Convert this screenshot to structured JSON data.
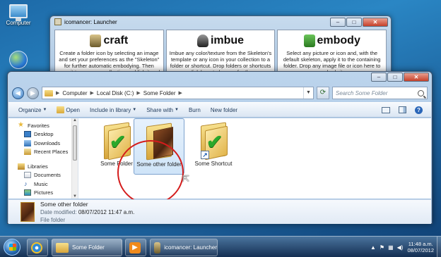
{
  "desktop": {
    "computer_label": "Computer"
  },
  "launcher": {
    "title": "icomancer: Launcher",
    "panels": [
      {
        "heading": "craft",
        "description": "Create a folder icon by selecting an image and set your preferences as the \"Skeleton\" for further automatic embodying. Then save it to your new collection, publish it and share it with your friends!"
      },
      {
        "heading": "imbue",
        "description": "Imbue any color/texture from the Skeleton's template or any icon in your collection to a folder or shortcut. Drop folders or shortcuts or click here to browse for them."
      },
      {
        "heading": "embody",
        "description": "Select any picture or icon and, with the default skeleton, apply it to the containing folder. Drop any image file or icon here to embody it."
      }
    ]
  },
  "explorer": {
    "breadcrumb": [
      "Computer",
      "Local Disk (C:)",
      "Some Folder"
    ],
    "search_placeholder": "Search Some Folder",
    "commands": {
      "organize": "Organize",
      "open": "Open",
      "include": "Include in library",
      "share": "Share with",
      "burn": "Burn",
      "new_folder": "New folder"
    },
    "nav": {
      "favorites": "Favorites",
      "desktop": "Desktop",
      "downloads": "Downloads",
      "recent": "Recent Places",
      "libraries": "Libraries",
      "documents": "Documents",
      "music": "Music",
      "pictures": "Pictures"
    },
    "files": [
      {
        "name": "Some Folder"
      },
      {
        "name": "Some other folder"
      },
      {
        "name": "Some Shortcut"
      }
    ],
    "details": {
      "name": "Some other folder",
      "date_label": "Date modified:",
      "date_value": "08/07/2012 11:47 a.m.",
      "type": "File folder"
    }
  },
  "taskbar": {
    "explorer_label": "Some Folder",
    "launcher_label": "icomancer: Launcher",
    "time": "11:48 a.m.",
    "date": "08/07/2012"
  },
  "colors": {
    "selection_circle": "#d41c1c",
    "check_green": "#2ba82b"
  }
}
